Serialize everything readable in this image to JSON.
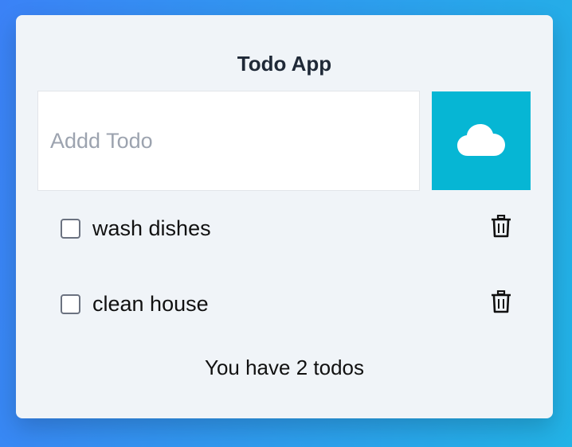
{
  "app": {
    "title": "Todo App"
  },
  "add_form": {
    "input_value": "",
    "input_placeholder": "Addd Todo",
    "button_icon": "cloud-icon",
    "button_color": "#06b6d4"
  },
  "todos": [
    {
      "label": "wash dishes",
      "checked": false,
      "delete_icon": "trash-icon"
    },
    {
      "label": "clean house",
      "checked": false,
      "delete_icon": "trash-icon"
    }
  ],
  "footer": {
    "count_text": "You have 2 todos"
  },
  "colors": {
    "background_gradient_start": "#3b82f6",
    "background_gradient_end": "#22b3e6",
    "card_background": "#f0f4f8"
  }
}
